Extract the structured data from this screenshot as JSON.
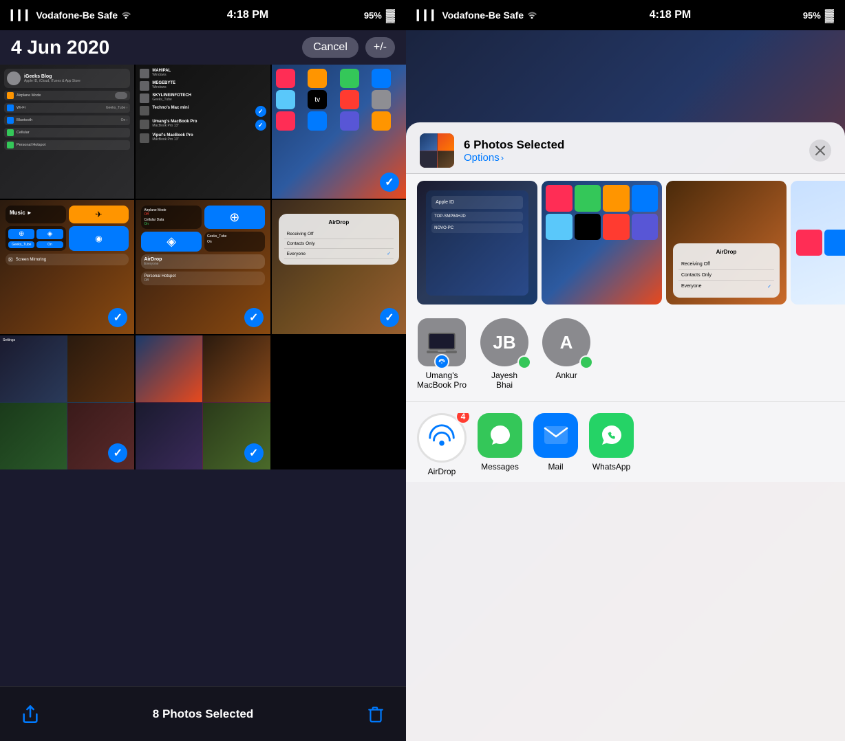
{
  "left_panel": {
    "status_bar": {
      "carrier": "Vodafone-Be Safe",
      "time": "4:18 PM",
      "battery": "95%"
    },
    "date_title": "4 Jun 2020",
    "cancel_label": "Cancel",
    "plus_minus_label": "+/-",
    "photos_count": "8 Photos Selected",
    "photos": [
      {
        "id": "p1",
        "type": "settings",
        "checked": false
      },
      {
        "id": "p2",
        "type": "homescreen",
        "checked": false
      },
      {
        "id": "p3",
        "type": "settings2",
        "checked": false
      },
      {
        "id": "p4",
        "type": "controlcenter",
        "checked": true
      },
      {
        "id": "p5",
        "type": "controlcenter2",
        "checked": true
      },
      {
        "id": "p6",
        "type": "airdrop",
        "checked": true
      },
      {
        "id": "p7",
        "type": "mixed1",
        "checked": true
      },
      {
        "id": "p8",
        "type": "mixed2",
        "checked": true
      }
    ],
    "settings_rows": [
      {
        "label": "iGeeks Blog",
        "sublabel": "Apple ID, iCloud, iTunes & App Store",
        "type": "profile"
      },
      {
        "label": "Airplane Mode",
        "type": "toggle",
        "color": "#ff9500",
        "on": false
      },
      {
        "label": "Wi-Fi",
        "type": "nav",
        "color": "#007aff",
        "value": "Geeks_Tube"
      },
      {
        "label": "Bluetooth",
        "type": "nav",
        "color": "#007aff",
        "value": "On"
      },
      {
        "label": "Cellular",
        "type": "nav",
        "color": "#34c759"
      },
      {
        "label": "Personal Hotspot",
        "type": "nav",
        "color": "#34c759"
      }
    ],
    "airdrop_menu": {
      "title": "AirDrop",
      "items": [
        "Receiving Off",
        "Contacts Only",
        "Everyone"
      ]
    }
  },
  "right_panel": {
    "status_bar": {
      "carrier": "Vodafone-Be Safe",
      "time": "4:18 PM",
      "battery": "95%"
    },
    "share_sheet": {
      "title": "6 Photos Selected",
      "options_label": "Options",
      "close_label": "×",
      "people": [
        {
          "name": "Umang's\nMacBook Pro",
          "type": "device",
          "has_airdrop": true
        },
        {
          "name": "Jayesh\nBhai",
          "type": "avatar",
          "initials": "JB",
          "bg": "#8a8a8e"
        },
        {
          "name": "Ankur",
          "type": "avatar",
          "initials": "A",
          "bg": "#8a8a8e"
        }
      ],
      "apps": [
        {
          "name": "AirDrop",
          "type": "airdrop",
          "badge": 4
        },
        {
          "name": "Messages",
          "type": "messages"
        },
        {
          "name": "Mail",
          "type": "mail"
        },
        {
          "name": "WhatsApp",
          "type": "whatsapp"
        }
      ]
    }
  },
  "icons": {
    "share": "↑",
    "trash": "🗑",
    "close": "✕",
    "chevron_right": "›",
    "wifi_signal": "📶",
    "battery": "🔋",
    "check": "✓"
  }
}
